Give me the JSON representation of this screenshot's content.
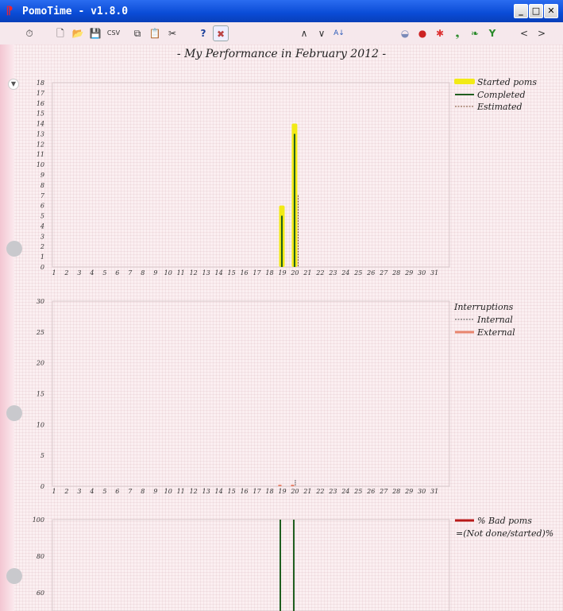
{
  "window": {
    "title": "PomoTime - v1.8.0",
    "controls": [
      "_",
      "□",
      "✕"
    ]
  },
  "toolbar": {
    "buttons": [
      {
        "name": "stopwatch-icon",
        "glyph": "⏱"
      },
      {
        "name": "new-icon",
        "glyph": "🗋"
      },
      {
        "name": "open-icon",
        "glyph": "📂"
      },
      {
        "name": "save-icon",
        "glyph": "💾"
      },
      {
        "name": "csv-export",
        "glyph": "CSV"
      },
      {
        "name": "copy-icon",
        "glyph": "⧉"
      },
      {
        "name": "paste-icon",
        "glyph": "📋"
      },
      {
        "name": "cut-icon",
        "glyph": "✂"
      },
      {
        "name": "help-icon",
        "glyph": "?"
      },
      {
        "name": "settings-tools-icon",
        "glyph": "✖"
      },
      {
        "name": "move-up-icon",
        "glyph": "∧"
      },
      {
        "name": "move-down-icon",
        "glyph": "∨"
      },
      {
        "name": "sort-az-icon",
        "glyph": "A↓"
      },
      {
        "name": "pot-icon",
        "glyph": "◒"
      },
      {
        "name": "tomato-icon",
        "glyph": "●"
      },
      {
        "name": "splat-icon",
        "glyph": "✱"
      },
      {
        "name": "note-icon",
        "glyph": "❟"
      },
      {
        "name": "leaf-icon",
        "glyph": "❧"
      },
      {
        "name": "sprout-icon",
        "glyph": "Y"
      },
      {
        "name": "prev-icon",
        "glyph": "<"
      },
      {
        "name": "next-icon",
        "glyph": ">"
      }
    ]
  },
  "page": {
    "title": "- My Performance in February 2012 -"
  },
  "colors": {
    "started": "#f2ea16",
    "completed": "#1f5e1f",
    "estimated": "#7a4a2a",
    "internal": "#444444",
    "external": "#e8856e",
    "bad": "#b81a1a",
    "grid": "#d8c8cc"
  },
  "chart_data": [
    {
      "type": "bar",
      "categories": [
        "1",
        "2",
        "3",
        "4",
        "5",
        "6",
        "7",
        "8",
        "9",
        "10",
        "11",
        "12",
        "13",
        "14",
        "15",
        "16",
        "17",
        "18",
        "19",
        "20",
        "21",
        "22",
        "23",
        "24",
        "25",
        "26",
        "27",
        "28",
        "29",
        "30",
        "31"
      ],
      "ylim": [
        0,
        18
      ],
      "yticks": [
        0,
        1,
        2,
        3,
        4,
        5,
        6,
        7,
        8,
        9,
        10,
        11,
        12,
        13,
        14,
        15,
        16,
        17,
        18
      ],
      "series": [
        {
          "name": "Started poms",
          "x": [
            "19",
            "20"
          ],
          "values": [
            6,
            14
          ]
        },
        {
          "name": "Completed",
          "x": [
            "19",
            "20"
          ],
          "values": [
            5,
            13
          ]
        },
        {
          "name": "Estimated",
          "x": [
            "20"
          ],
          "values": [
            7
          ]
        }
      ]
    },
    {
      "type": "bar",
      "categories": [
        "1",
        "2",
        "3",
        "4",
        "5",
        "6",
        "7",
        "8",
        "9",
        "10",
        "11",
        "12",
        "13",
        "14",
        "15",
        "16",
        "17",
        "18",
        "19",
        "20",
        "21",
        "22",
        "23",
        "24",
        "25",
        "26",
        "27",
        "28",
        "29",
        "30",
        "31"
      ],
      "ylim": [
        0,
        30
      ],
      "yticks": [
        0,
        5,
        10,
        15,
        20,
        25,
        30
      ],
      "legend_title": "Interruptions",
      "series": [
        {
          "name": "Internal",
          "x": [
            "20"
          ],
          "values": [
            1
          ]
        },
        {
          "name": "External",
          "x": [
            "19",
            "20"
          ],
          "values": [
            0,
            0
          ]
        }
      ]
    },
    {
      "type": "bar",
      "ylim": [
        60,
        100
      ],
      "yticks": [
        60,
        80,
        100
      ],
      "series": [
        {
          "name": "% Bad poms",
          "x": [
            "19",
            "20"
          ],
          "values": [
            100,
            100
          ]
        }
      ],
      "legend_note": "=(Not done/started)%"
    }
  ]
}
